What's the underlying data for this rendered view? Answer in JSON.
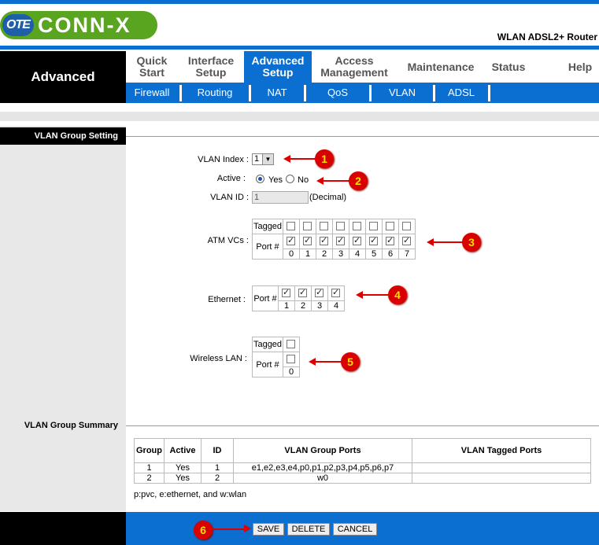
{
  "header": {
    "logo_ote": "OTE",
    "logo_brand": "CONN-X",
    "product": "WLAN ADSL2+ Router"
  },
  "sidebar": {
    "title": "Advanced"
  },
  "main_tabs": [
    {
      "label": "Quick Start"
    },
    {
      "label": "Interface Setup"
    },
    {
      "label": "Advanced Setup"
    },
    {
      "label": "Access Management"
    },
    {
      "label": "Maintenance"
    },
    {
      "label": "Status"
    },
    {
      "label": "Help"
    }
  ],
  "sub_tabs": [
    "Firewall",
    "Routing",
    "NAT",
    "QoS",
    "VLAN",
    "ADSL"
  ],
  "vlan_setting": {
    "section_title": "VLAN Group Setting",
    "vlan_index_label": "VLAN Index :",
    "vlan_index_value": "1",
    "active_label": "Active :",
    "active_yes": "Yes",
    "active_no": "No",
    "active_selected": "Yes",
    "vlan_id_label": "VLAN ID :",
    "vlan_id_value": "1",
    "vlan_id_unit": "(Decimal)",
    "atm_label": "ATM VCs :",
    "tagged_label": "Tagged",
    "port_label": "Port #",
    "atm_ports": [
      "0",
      "1",
      "2",
      "3",
      "4",
      "5",
      "6",
      "7"
    ],
    "ethernet_label": "Ethernet :",
    "ethernet_ports": [
      "1",
      "2",
      "3",
      "4"
    ],
    "wlan_label": "Wireless LAN :",
    "wlan_ports": [
      "0"
    ]
  },
  "summary": {
    "section_title": "VLAN Group Summary",
    "columns": [
      "Group",
      "Active",
      "ID",
      "VLAN Group Ports",
      "VLAN Tagged Ports"
    ],
    "rows": [
      [
        "1",
        "Yes",
        "1",
        "e1,e2,e3,e4,p0,p1,p2,p3,p4,p5,p6,p7",
        ""
      ],
      [
        "2",
        "Yes",
        "2",
        "w0",
        ""
      ]
    ],
    "legend": "p:pvc, e:ethernet, and w:wlan"
  },
  "buttons": {
    "save": "SAVE",
    "delete": "DELETE",
    "cancel": "CANCEL"
  },
  "annotations": [
    "1",
    "2",
    "3",
    "4",
    "5",
    "6"
  ],
  "colors": {
    "brand_blue": "#0a6fd0",
    "logo_green": "#5aa51f",
    "annotation_red": "#d90000"
  }
}
